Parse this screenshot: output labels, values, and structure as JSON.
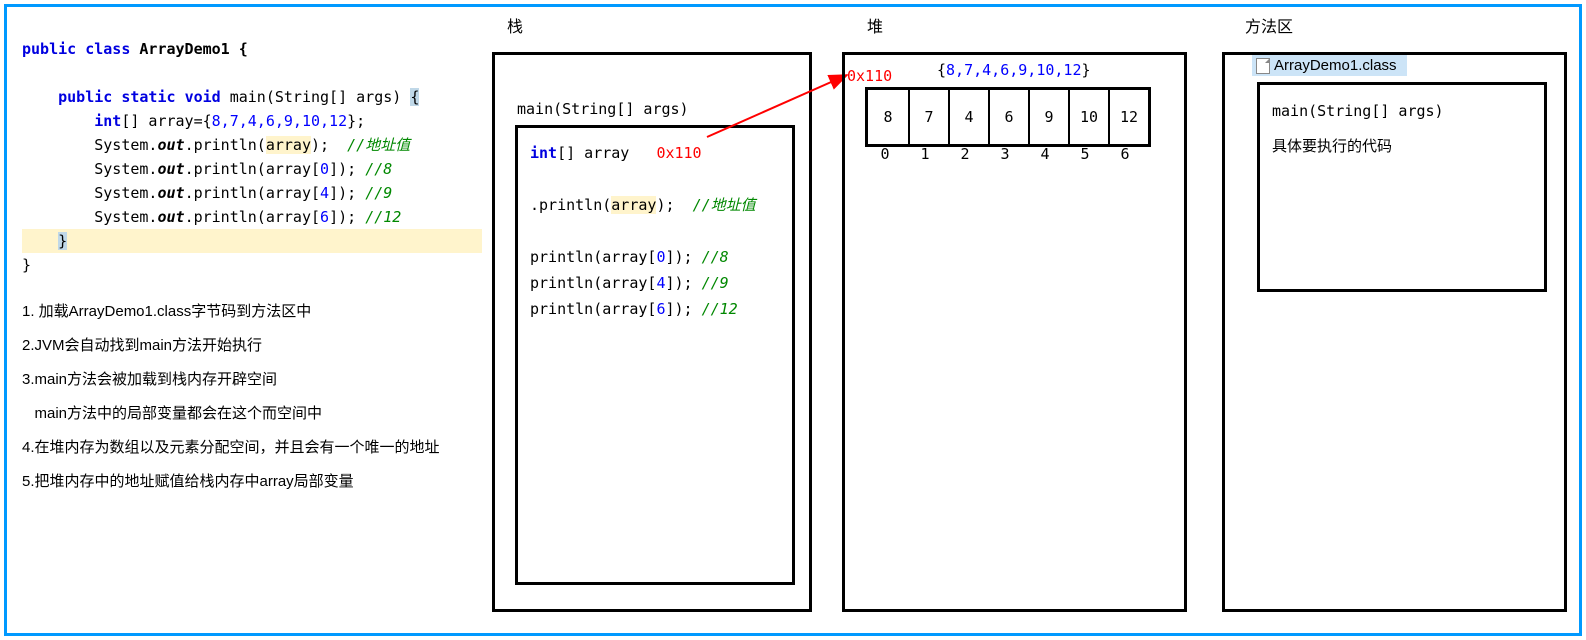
{
  "labels": {
    "stack": "栈",
    "heap": "堆",
    "method_area": "方法区"
  },
  "code": {
    "kw_public": "public",
    "kw_class": "class",
    "class_name": " ArrayDemo1 {",
    "kw_static": "static",
    "kw_void": "void",
    "kw_int": "int",
    "method_sig_pre": " main(String[] args) ",
    "brace_open": "{",
    "array_decl_pre": "[] array={",
    "array_vals": "8,7,4,6,9,10,12",
    "array_decl_post": "};",
    "print_pre": "System.",
    "out": "out",
    "print_open": ".println(",
    "arr_var": "array",
    "print_close": ");",
    "cmt_addr": "//地址值",
    "idx0": "0",
    "idx4": "4",
    "idx6": "6",
    "cmt8": "//8",
    "cmt9": "//9",
    "cmt12": "//12",
    "brace_close": "}"
  },
  "explain": {
    "l1": "1. 加载ArrayDemo1.class字节码到方法区中",
    "l2": "2.JVM会自动找到main方法开始执行",
    "l3a": "3.main方法会被加载到栈内存开辟空间",
    "l3b": "   main方法中的局部变量都会在这个而空间中",
    "l4": "4.在堆内存为数组以及元素分配空间，并且会有一个唯一的地址",
    "l5": "5.把堆内存中的地址赋值给栈内存中array局部变量"
  },
  "stack": {
    "main_sig": "main(String[] args)",
    "int_arr": "int",
    "arr_decl": "[] array",
    "addr": "0x110",
    "println": ".println(",
    "arr": "array",
    "close": ");",
    "cmt_addr": "//地址值",
    "p0_pre": "println(array[",
    "p0_idx": "0",
    "p0_post": "]);",
    "p0_cmt": "//8",
    "p4_idx": "4",
    "p4_cmt": "//9",
    "p6_idx": "6",
    "p6_cmt": "//12"
  },
  "heap": {
    "addr": "0x110",
    "init_pre": "{",
    "init_vals": "8,7,4,6,9,10,12",
    "init_post": "}",
    "cells": [
      "8",
      "7",
      "4",
      "6",
      "9",
      "10",
      "12"
    ],
    "indices": [
      "0",
      "1",
      "2",
      "3",
      "4",
      "5",
      "6"
    ]
  },
  "method_area": {
    "class_file": "ArrayDemo1.class",
    "main_sig": "main(String[] args)",
    "desc": "具体要执行的代码"
  }
}
